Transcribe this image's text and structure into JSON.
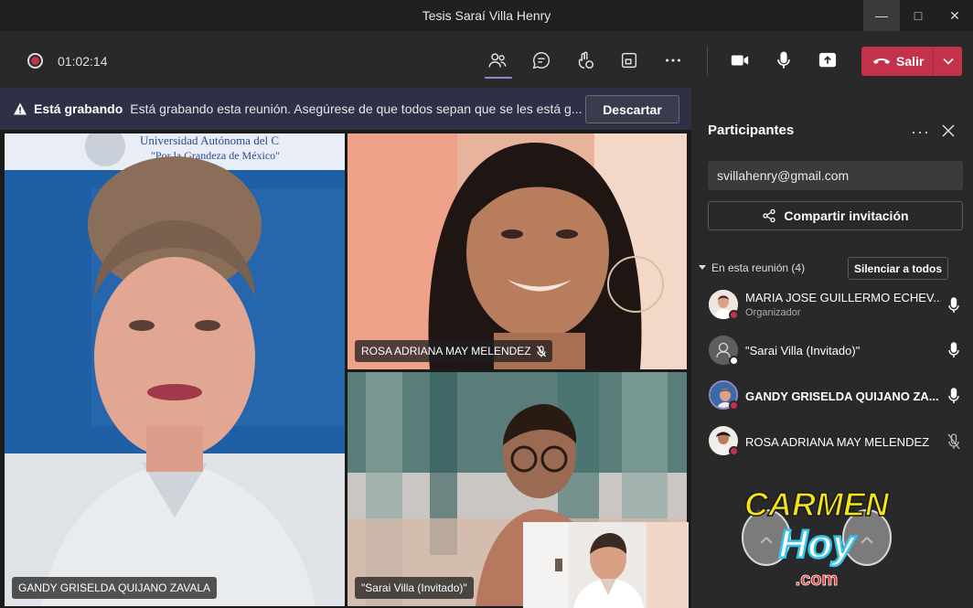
{
  "window": {
    "title": "Tesis Saraí Villa Henry"
  },
  "toolbar": {
    "timer": "01:02:14",
    "leave_label": "Salir"
  },
  "banner": {
    "title": "Está grabando",
    "message": "Está grabando esta reunión. Asegúrese de que todos sepan que se les está g...",
    "dismiss_label": "Descartar"
  },
  "videos": [
    {
      "name": "GANDY GRISELDA QUIJANO ZAVALA"
    },
    {
      "name": "ROSA ADRIANA MAY MELENDEZ"
    },
    {
      "name": "\"Sarai Villa (Invitado)\""
    }
  ],
  "slide_text": {
    "university": "Universidad Autónoma del C",
    "motto": "\"Por la Grandeza de México\""
  },
  "participants": {
    "title": "Participantes",
    "invite_email": "svillahenry@gmail.com",
    "share_label": "Compartir invitación",
    "section_label": "En esta reunión (4)",
    "mute_all_label": "Silenciar a todos",
    "people": [
      {
        "name": "MARIA JOSE GUILLERMO ECHEV...",
        "role": "Organizador"
      },
      {
        "name": "\"Sarai Villa (Invitado)\""
      },
      {
        "name": "GANDY GRISELDA QUIJANO ZA..."
      },
      {
        "name": "ROSA ADRIANA MAY MELENDEZ"
      }
    ]
  },
  "watermark": {
    "line1": "CARMEN",
    "line2": "Hoy",
    "line3": ".com"
  },
  "colors": {
    "leave": "#c4314b",
    "accent": "#8b8cc7",
    "banner_bg": "#2e3046",
    "panel_bg": "#292929"
  }
}
